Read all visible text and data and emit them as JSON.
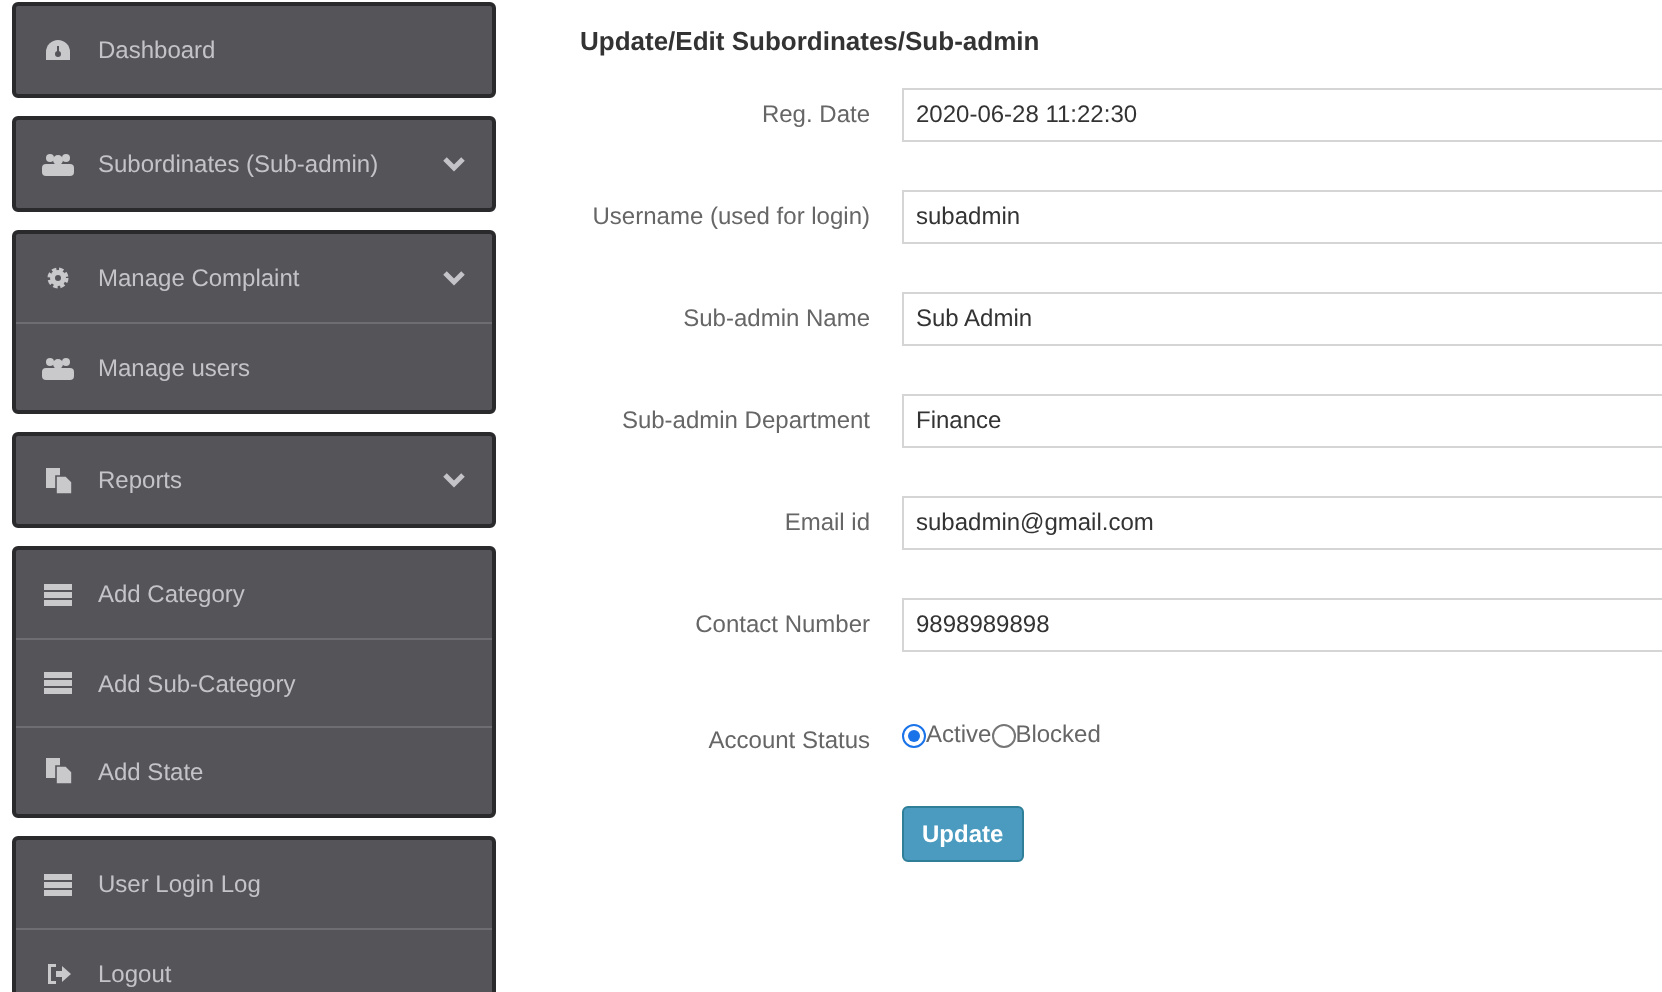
{
  "sidebar": {
    "groups": [
      {
        "items": [
          {
            "label": "Dashboard",
            "kind": "dashboard",
            "expandable": false
          }
        ]
      },
      {
        "items": [
          {
            "label": "Subordinates (Sub-admin)",
            "kind": "users",
            "expandable": true
          }
        ]
      },
      {
        "items": [
          {
            "label": "Manage Complaint",
            "kind": "gear",
            "expandable": true
          },
          {
            "label": "Manage users",
            "kind": "users",
            "expandable": false
          }
        ]
      },
      {
        "items": [
          {
            "label": "Reports",
            "kind": "copy",
            "expandable": true
          }
        ]
      },
      {
        "items": [
          {
            "label": "Add Category",
            "kind": "list",
            "expandable": false
          },
          {
            "label": "Add Sub-Category",
            "kind": "list",
            "expandable": false
          },
          {
            "label": "Add State",
            "kind": "copy",
            "expandable": false
          }
        ]
      },
      {
        "items": [
          {
            "label": "User Login Log",
            "kind": "list",
            "expandable": false
          },
          {
            "label": "Logout",
            "kind": "logout",
            "expandable": false
          }
        ]
      }
    ]
  },
  "form": {
    "title": "Update/Edit Subordinates/Sub-admin",
    "fields": [
      {
        "label": "Reg. Date",
        "value": "2020-06-28 11:22:30"
      },
      {
        "label": "Username (used for login)",
        "value": "subadmin"
      },
      {
        "label": "Sub-admin Name",
        "value": "Sub Admin"
      },
      {
        "label": "Sub-admin Department",
        "value": "Finance"
      },
      {
        "label": "Email id",
        "value": "subadmin@gmail.com"
      },
      {
        "label": "Contact Number",
        "value": "9898989898"
      }
    ],
    "status": {
      "label": "Account Status",
      "options": [
        {
          "label": "Active",
          "selected": true
        },
        {
          "label": "Blocked",
          "selected": false
        }
      ]
    },
    "submit": "Update"
  }
}
